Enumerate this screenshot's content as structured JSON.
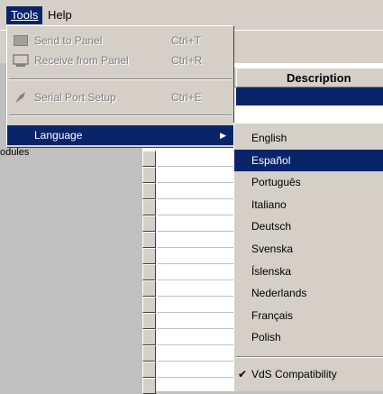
{
  "menubar": {
    "tools": "Tools",
    "help": "Help"
  },
  "grid": {
    "description_header": "Description",
    "modules_text": "odules"
  },
  "tools_menu": {
    "send_to_panel": {
      "label": "Send to Panel",
      "shortcut": "Ctrl+T"
    },
    "receive_from_panel": {
      "label": "Receive from Panel",
      "shortcut": "Ctrl+R"
    },
    "serial_port_setup": {
      "label": "Serial Port Setup",
      "shortcut": "Ctrl+E"
    },
    "language": {
      "label": "Language"
    }
  },
  "language_menu": {
    "items": [
      "English",
      "Español",
      "Português",
      "Italiano",
      "Deutsch",
      "Svenska",
      "Íslenska",
      "Nederlands",
      "Français",
      "Polish"
    ],
    "selected": "Español",
    "vds_compat": "VdS Compatibility"
  },
  "icons": {
    "send": "panel-send-icon",
    "receive": "panel-receive-icon",
    "serial": "serial-port-icon",
    "arrow": "submenu-arrow-icon",
    "check": "checkmark-icon"
  }
}
